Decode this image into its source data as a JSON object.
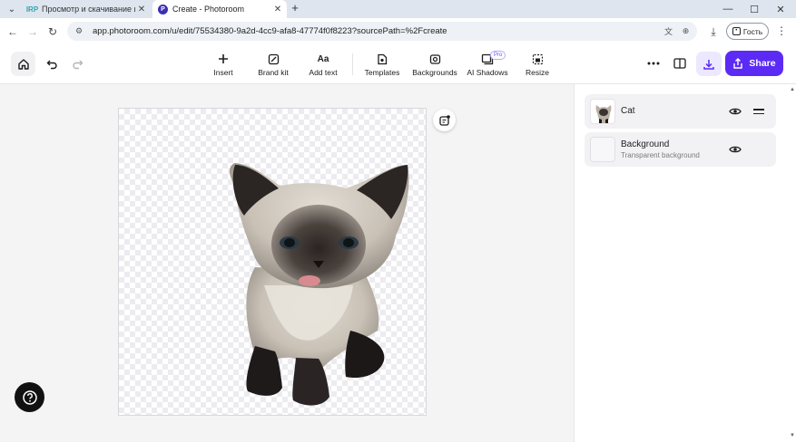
{
  "browser": {
    "tabs": [
      {
        "favicon": "IRP",
        "title": "Просмотр и скачивание изоб",
        "active": false
      },
      {
        "favicon": "P",
        "title": "Create - Photoroom",
        "active": true
      }
    ],
    "url": "app.photoroom.com/u/edit/75534380-9a2d-4cc9-afa8-47774f0f8223?sourcePath=%2Fcreate",
    "profile_label": "Гость"
  },
  "toolbar": {
    "tools": [
      {
        "label": "Insert",
        "icon": "plus-icon"
      },
      {
        "label": "Brand kit",
        "icon": "brand-kit-icon"
      },
      {
        "label": "Add text",
        "icon": "text-icon",
        "glyph": "Aa"
      },
      {
        "label": "Templates",
        "icon": "templates-icon"
      },
      {
        "label": "Backgrounds",
        "icon": "backgrounds-icon"
      },
      {
        "label": "AI Shadows",
        "icon": "ai-shadows-icon",
        "badge": "Pro"
      },
      {
        "label": "Resize",
        "icon": "resize-icon"
      }
    ],
    "share_label": "Share"
  },
  "layers": [
    {
      "name": "Cat",
      "subtitle": "",
      "visible": true
    },
    {
      "name": "Background",
      "subtitle": "Transparent background",
      "visible": true
    }
  ],
  "colors": {
    "accent": "#5b2bf5",
    "accent_soft": "#ece8ff"
  }
}
